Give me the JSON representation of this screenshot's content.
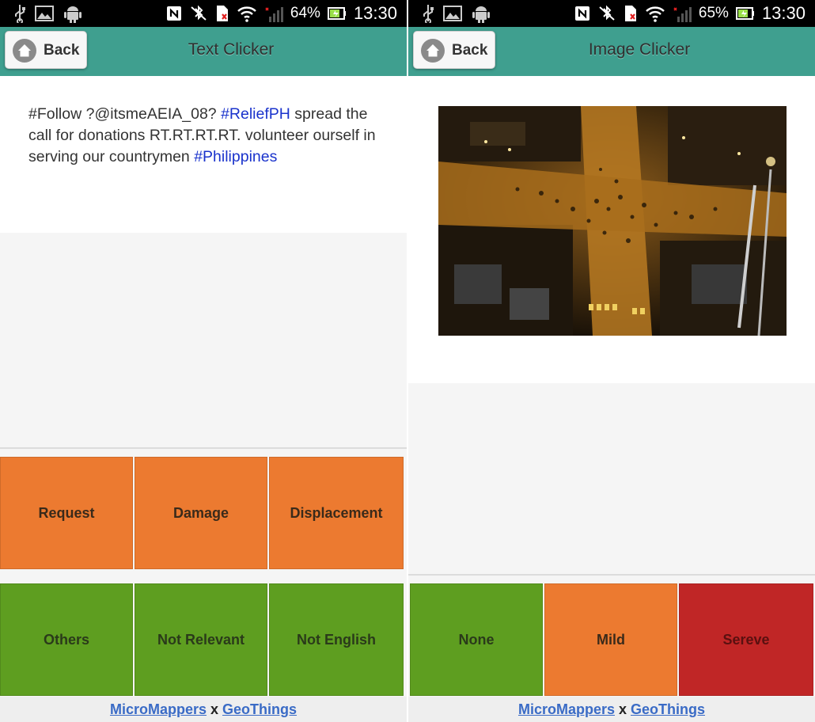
{
  "left": {
    "status": {
      "battery": "64%",
      "time": "13:30"
    },
    "back_label": "Back",
    "title": "Text Clicker",
    "tweet": {
      "part1": "#Follow ?@itsmeAEIA_08? ",
      "hashtag1": "#ReliefPH",
      "part2": " spread the call for donations RT.RT.RT.RT. volunteer ourself in serving our countrymen ",
      "hashtag2": "#Philippines"
    },
    "buttons": {
      "request": "Request",
      "damage": "Damage",
      "displacement": "Displacement",
      "others": "Others",
      "not_relevant": "Not Relevant",
      "not_english": "Not English"
    },
    "footer": {
      "link1": "MicroMappers",
      "sep": " x ",
      "link2": "GeoThings"
    }
  },
  "right": {
    "status": {
      "battery": "65%",
      "time": "13:30"
    },
    "back_label": "Back",
    "title": "Image Clicker",
    "buttons": {
      "none": "None",
      "mild": "Mild",
      "severe": "Sereve"
    },
    "footer": {
      "link1": "MicroMappers",
      "sep": " x ",
      "link2": "GeoThings"
    }
  },
  "colors": {
    "header": "#3f9f8f",
    "orange": "#ec7a30",
    "green": "#5e9e20",
    "red": "#c02626",
    "hashtag": "#1a33cc",
    "link": "#3a6bc6"
  },
  "icons": [
    "usb-icon",
    "gallery-icon",
    "android-icon",
    "nfc-icon",
    "bluetooth-off-icon",
    "sim-icon",
    "wifi-icon",
    "signal-icon",
    "battery-icon",
    "home-icon"
  ]
}
